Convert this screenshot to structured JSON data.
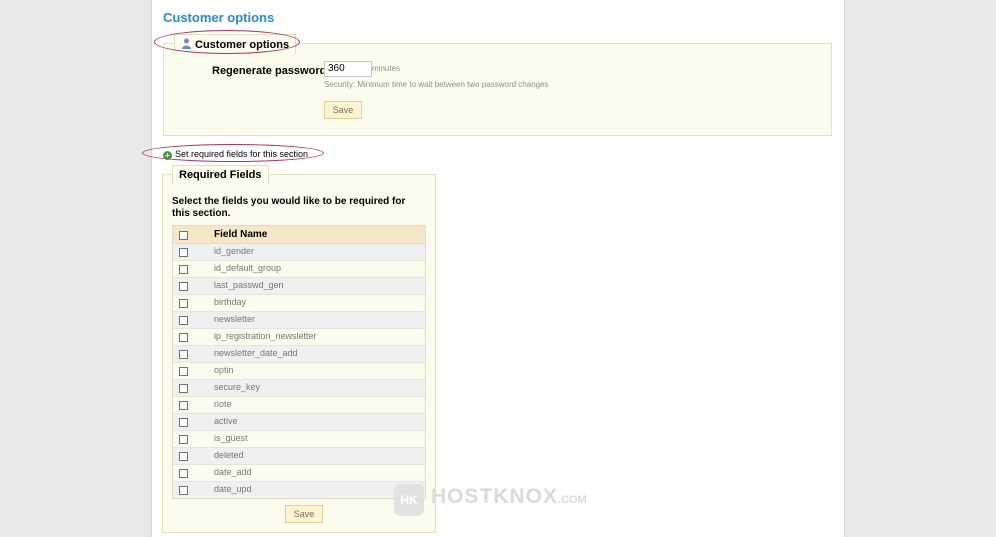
{
  "page_title": "Customer options",
  "customer_options": {
    "legend": "Customer options",
    "regenerate_label": "Regenerate password:",
    "regenerate_value": "360",
    "unit": "minutes",
    "hint": "Security: Minimum time to wait between two password changes",
    "save_label": "Save"
  },
  "required_link": "Set required fields for this section",
  "required_fields": {
    "legend": "Required Fields",
    "instructions": "Select the fields you would like to be required for this section.",
    "column_header": "Field Name",
    "rows": [
      "id_gender",
      "id_default_group",
      "last_passwd_gen",
      "birthday",
      "newsletter",
      "ip_registration_newsletter",
      "newsletter_date_add",
      "optin",
      "secure_key",
      "note",
      "active",
      "is_guest",
      "deleted",
      "date_add",
      "date_upd"
    ],
    "save_label": "Save"
  },
  "watermark": {
    "mark": "HK",
    "text": "HOSTKNOX",
    "suffix": ".COM"
  },
  "colors": {
    "title": "#268ccd",
    "fieldset_bg": "#fcfcee",
    "highlight_ellipse": "#b03060",
    "button_bg": "#fff3d1"
  }
}
